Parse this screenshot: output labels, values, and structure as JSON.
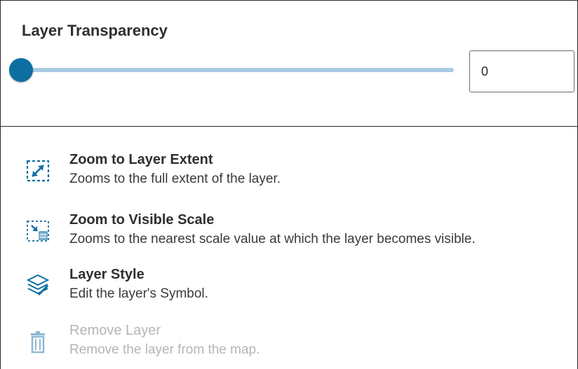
{
  "transparency": {
    "title": "Layer Transparency",
    "slider_value": 0,
    "input_value": "0"
  },
  "actions": [
    {
      "title": "Zoom to Layer Extent",
      "description": "Zooms to the full extent of the layer.",
      "icon": "zoom-extent-icon",
      "enabled": true
    },
    {
      "title": "Zoom to Visible Scale",
      "description": "Zooms to the nearest scale value at which the layer becomes visible.",
      "icon": "zoom-visible-scale-icon",
      "enabled": true
    },
    {
      "title": "Layer Style",
      "description": "Edit the layer's Symbol.",
      "icon": "layer-style-icon",
      "enabled": true
    },
    {
      "title": "Remove Layer",
      "description": "Remove the layer from the map.",
      "icon": "trash-icon",
      "enabled": false
    }
  ],
  "colors": {
    "accent": "#0d6ea1",
    "track": "#a7cbe2",
    "disabled": "#b5b5b5",
    "icon_light": "#8fb8d4"
  }
}
